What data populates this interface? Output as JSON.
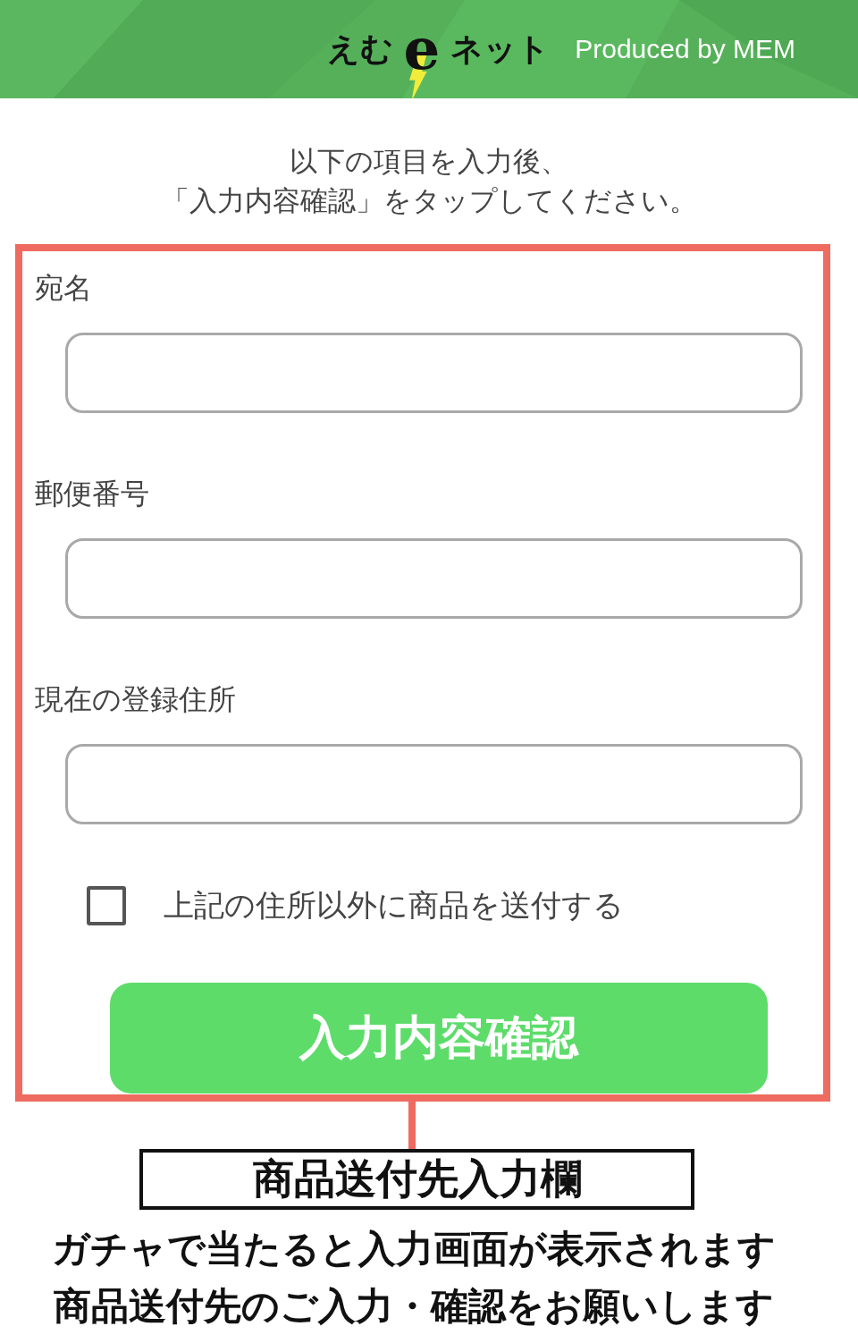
{
  "header": {
    "logo": [
      "えむ",
      "e",
      "ネット"
    ],
    "tagline": "Produced by MEM"
  },
  "instructions": [
    "以下の項目を入力後、",
    "「入力内容確認」をタップしてください。"
  ],
  "form": {
    "fields": [
      {
        "label": "宛名"
      },
      {
        "label": "郵便番号"
      },
      {
        "label": "現在の登録住所"
      }
    ],
    "checkbox": {
      "label": "上記の住所以外に商品を送付する",
      "checked": false
    },
    "button": "入力内容確認"
  },
  "callout": {
    "title": "商品送付先入力欄",
    "lines": [
      "ガチャで当たると入力画面が表示されます",
      "商品送付先のご入力・確認をお願いします"
    ]
  }
}
